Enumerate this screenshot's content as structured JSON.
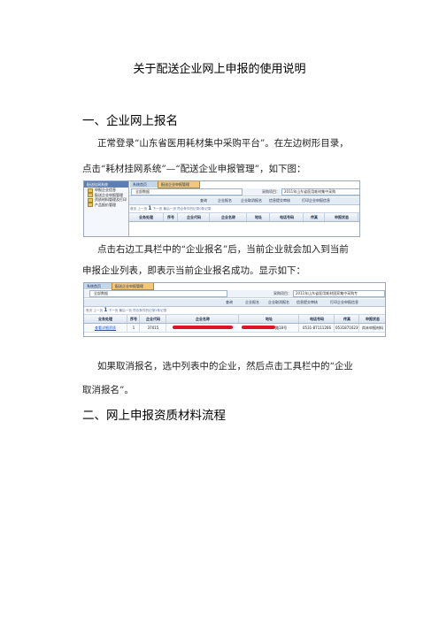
{
  "doc": {
    "title": "关于配送企业网上申报的使用说明",
    "section1_heading": "一、企业网上报名",
    "para1_line1": "正常登录“山东省医用耗材集中采购平台”。在左边树形目录，",
    "para1_line2": "点击“耗材挂网系统”—“配送企业申报管理”，如下图：",
    "para2_line1": "点击右边工具栏中的“企业报名”后，当前企业就会加入到当前",
    "para2_line2": "申报企业列表，即表示当前企业报名成功。显示如下：",
    "para3_line1": "如果取消报名，选中列表中的企业，然后点击工具栏中的“企业",
    "para3_line2": "取消报名”。",
    "section2_heading": "二、网上申报资质材料流程"
  },
  "screenshot1": {
    "tab_home": "系统首页",
    "tab_active": "配送企业申报管理",
    "left_panel_title": "配送挂网系统",
    "left_items": [
      "申报企业信息",
      "配送企业申报管理",
      "资质材料管理及打印",
      "产品报价管理"
    ],
    "category_select": "全部数据",
    "project_label": "采购项目：",
    "project_value": "2011年山东省医用耗材集中采购",
    "toolbar_buttons": [
      "查询",
      "企业报名",
      "企业取消报名",
      "信息提交审核",
      "打印企业申报信息"
    ],
    "pager_prefix": "首页  上一页",
    "pager_page": "1",
    "pager_suffix": "下一页  最后一页    符合条件的记录0条记录",
    "columns": [
      "业务处理",
      "序号",
      "企业代码",
      "企业名称",
      "地址",
      "电话号码",
      "传真",
      "申报状态"
    ]
  },
  "screenshot2": {
    "tab_home": "系统首页",
    "tab_active": "配送企业申报管理",
    "category_select": "全部数据",
    "project_label": "采购项目：",
    "project_value": "2011年山东省医用耗材国家集中采购专",
    "toolbar_buttons": [
      "查询",
      "企业报名",
      "企业取消报名",
      "信息提交审核",
      "打印企业申报信息"
    ],
    "pager_prefix": "首页  上一页",
    "pager_page": "1",
    "pager_suffix": "下一页  最后一页    符合条件的记录1条记录",
    "columns": [
      "业务处理",
      "序号",
      "企业代码",
      "企业名称",
      "地址",
      "电话号码",
      "传真",
      "申报状态"
    ],
    "row": {
      "action": "查看详细资质",
      "index": "1",
      "code": "37015",
      "address_tail": "路18号",
      "phone": "0531-87111266",
      "fax": "053187162399",
      "status": "尚未申报材料"
    }
  }
}
